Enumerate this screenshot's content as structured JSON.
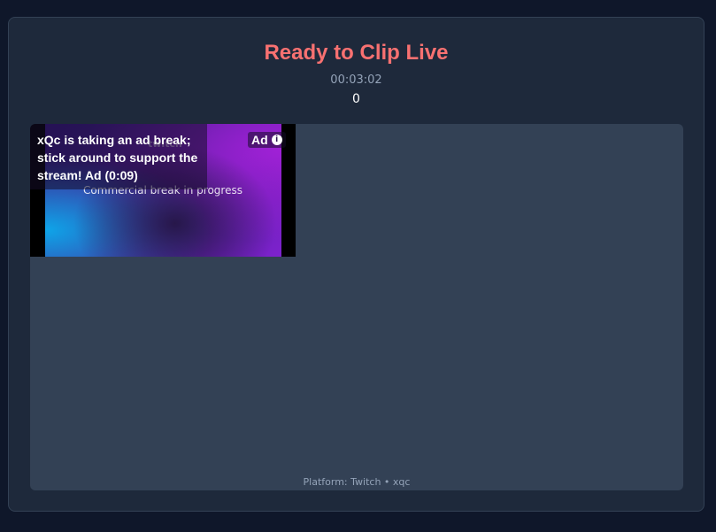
{
  "header": {
    "title": "Ready to Clip Live",
    "timer": "00:03:02",
    "count": "0"
  },
  "player": {
    "brand": "twitch",
    "commercial_text": "Commercial break in progress",
    "ad_message": "xQc is taking an ad break; stick around to support the stream! Ad (0:09)",
    "ad_badge": "Ad",
    "info_icon": "info-icon"
  },
  "footer": {
    "platform_text": "Platform: Twitch • xqc"
  },
  "colors": {
    "title": "#f87171",
    "panel": "#1e293b",
    "player_area": "#334155",
    "background": "#0f172a"
  }
}
